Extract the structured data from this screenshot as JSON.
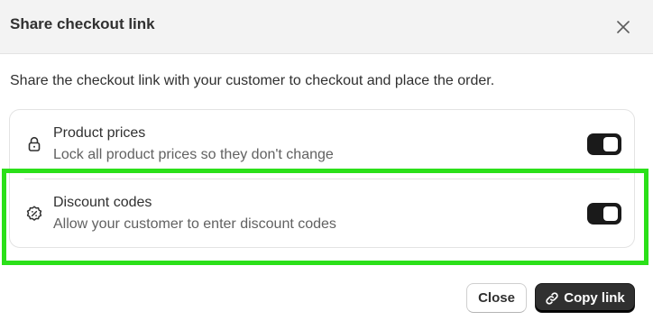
{
  "modal": {
    "title": "Share checkout link",
    "description": "Share the checkout link with your customer to checkout and place the order."
  },
  "options": [
    {
      "icon": "lock-icon",
      "title": "Product prices",
      "subtitle": "Lock all product prices so they don't change",
      "enabled": true
    },
    {
      "icon": "discount-badge-icon",
      "title": "Discount codes",
      "subtitle": "Allow your customer to enter discount codes",
      "enabled": true
    }
  ],
  "footer": {
    "close_label": "Close",
    "copy_label": "Copy link",
    "copy_icon": "link-icon"
  },
  "colors": {
    "highlight": "#2be019",
    "toggle_on": "#1a1a1a",
    "primary_button": "#303030"
  }
}
